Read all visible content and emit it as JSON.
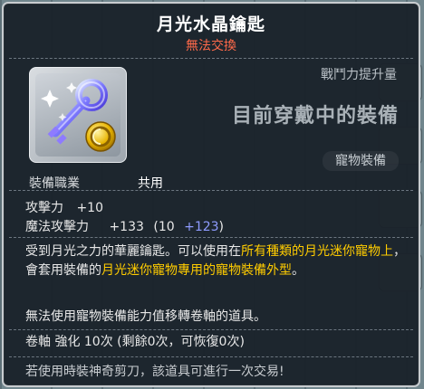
{
  "item": {
    "name": "月光水晶鑰匙",
    "trade_status": "無法交換",
    "combat_power_label": "戰鬥力提升量",
    "equipped_notice": "目前穿戴中的裝備",
    "category_badge": "寵物裝備",
    "job_label": "裝備職業",
    "job_value": "共用",
    "stats": {
      "atk_label": "攻擊力",
      "atk_value": "+10",
      "matk_label": "魔法攻擊力",
      "matk_value": "+133",
      "matk_base": "(10",
      "matk_bonus": "+123",
      "matk_close": ")"
    },
    "description": {
      "p1_a": "受到月光之力的華麗鑰匙。可以使用在",
      "p1_h1": "所有種類的月光迷你寵物上",
      "p1_b": "，會套用裝備的",
      "p1_h2": "月光迷你寵物專用的寵物裝備外型",
      "p1_c": "。",
      "p2": "無法使用寵物裝備能力值移轉卷軸的道具。",
      "p3": "卷軸 強化 10次 (剩餘0次，可恢復0次)"
    },
    "footer": "若使用時裝神奇剪刀，該道具可進行一次交易!"
  },
  "icons": {
    "item_icon": "crystal-key-icon",
    "coin": "gold-coin-icon"
  },
  "colors": {
    "title": "#ffffff",
    "trade_status": "#ff6a4a",
    "highlight": "#ffcc00",
    "bonus_blue": "#8f9cff"
  }
}
